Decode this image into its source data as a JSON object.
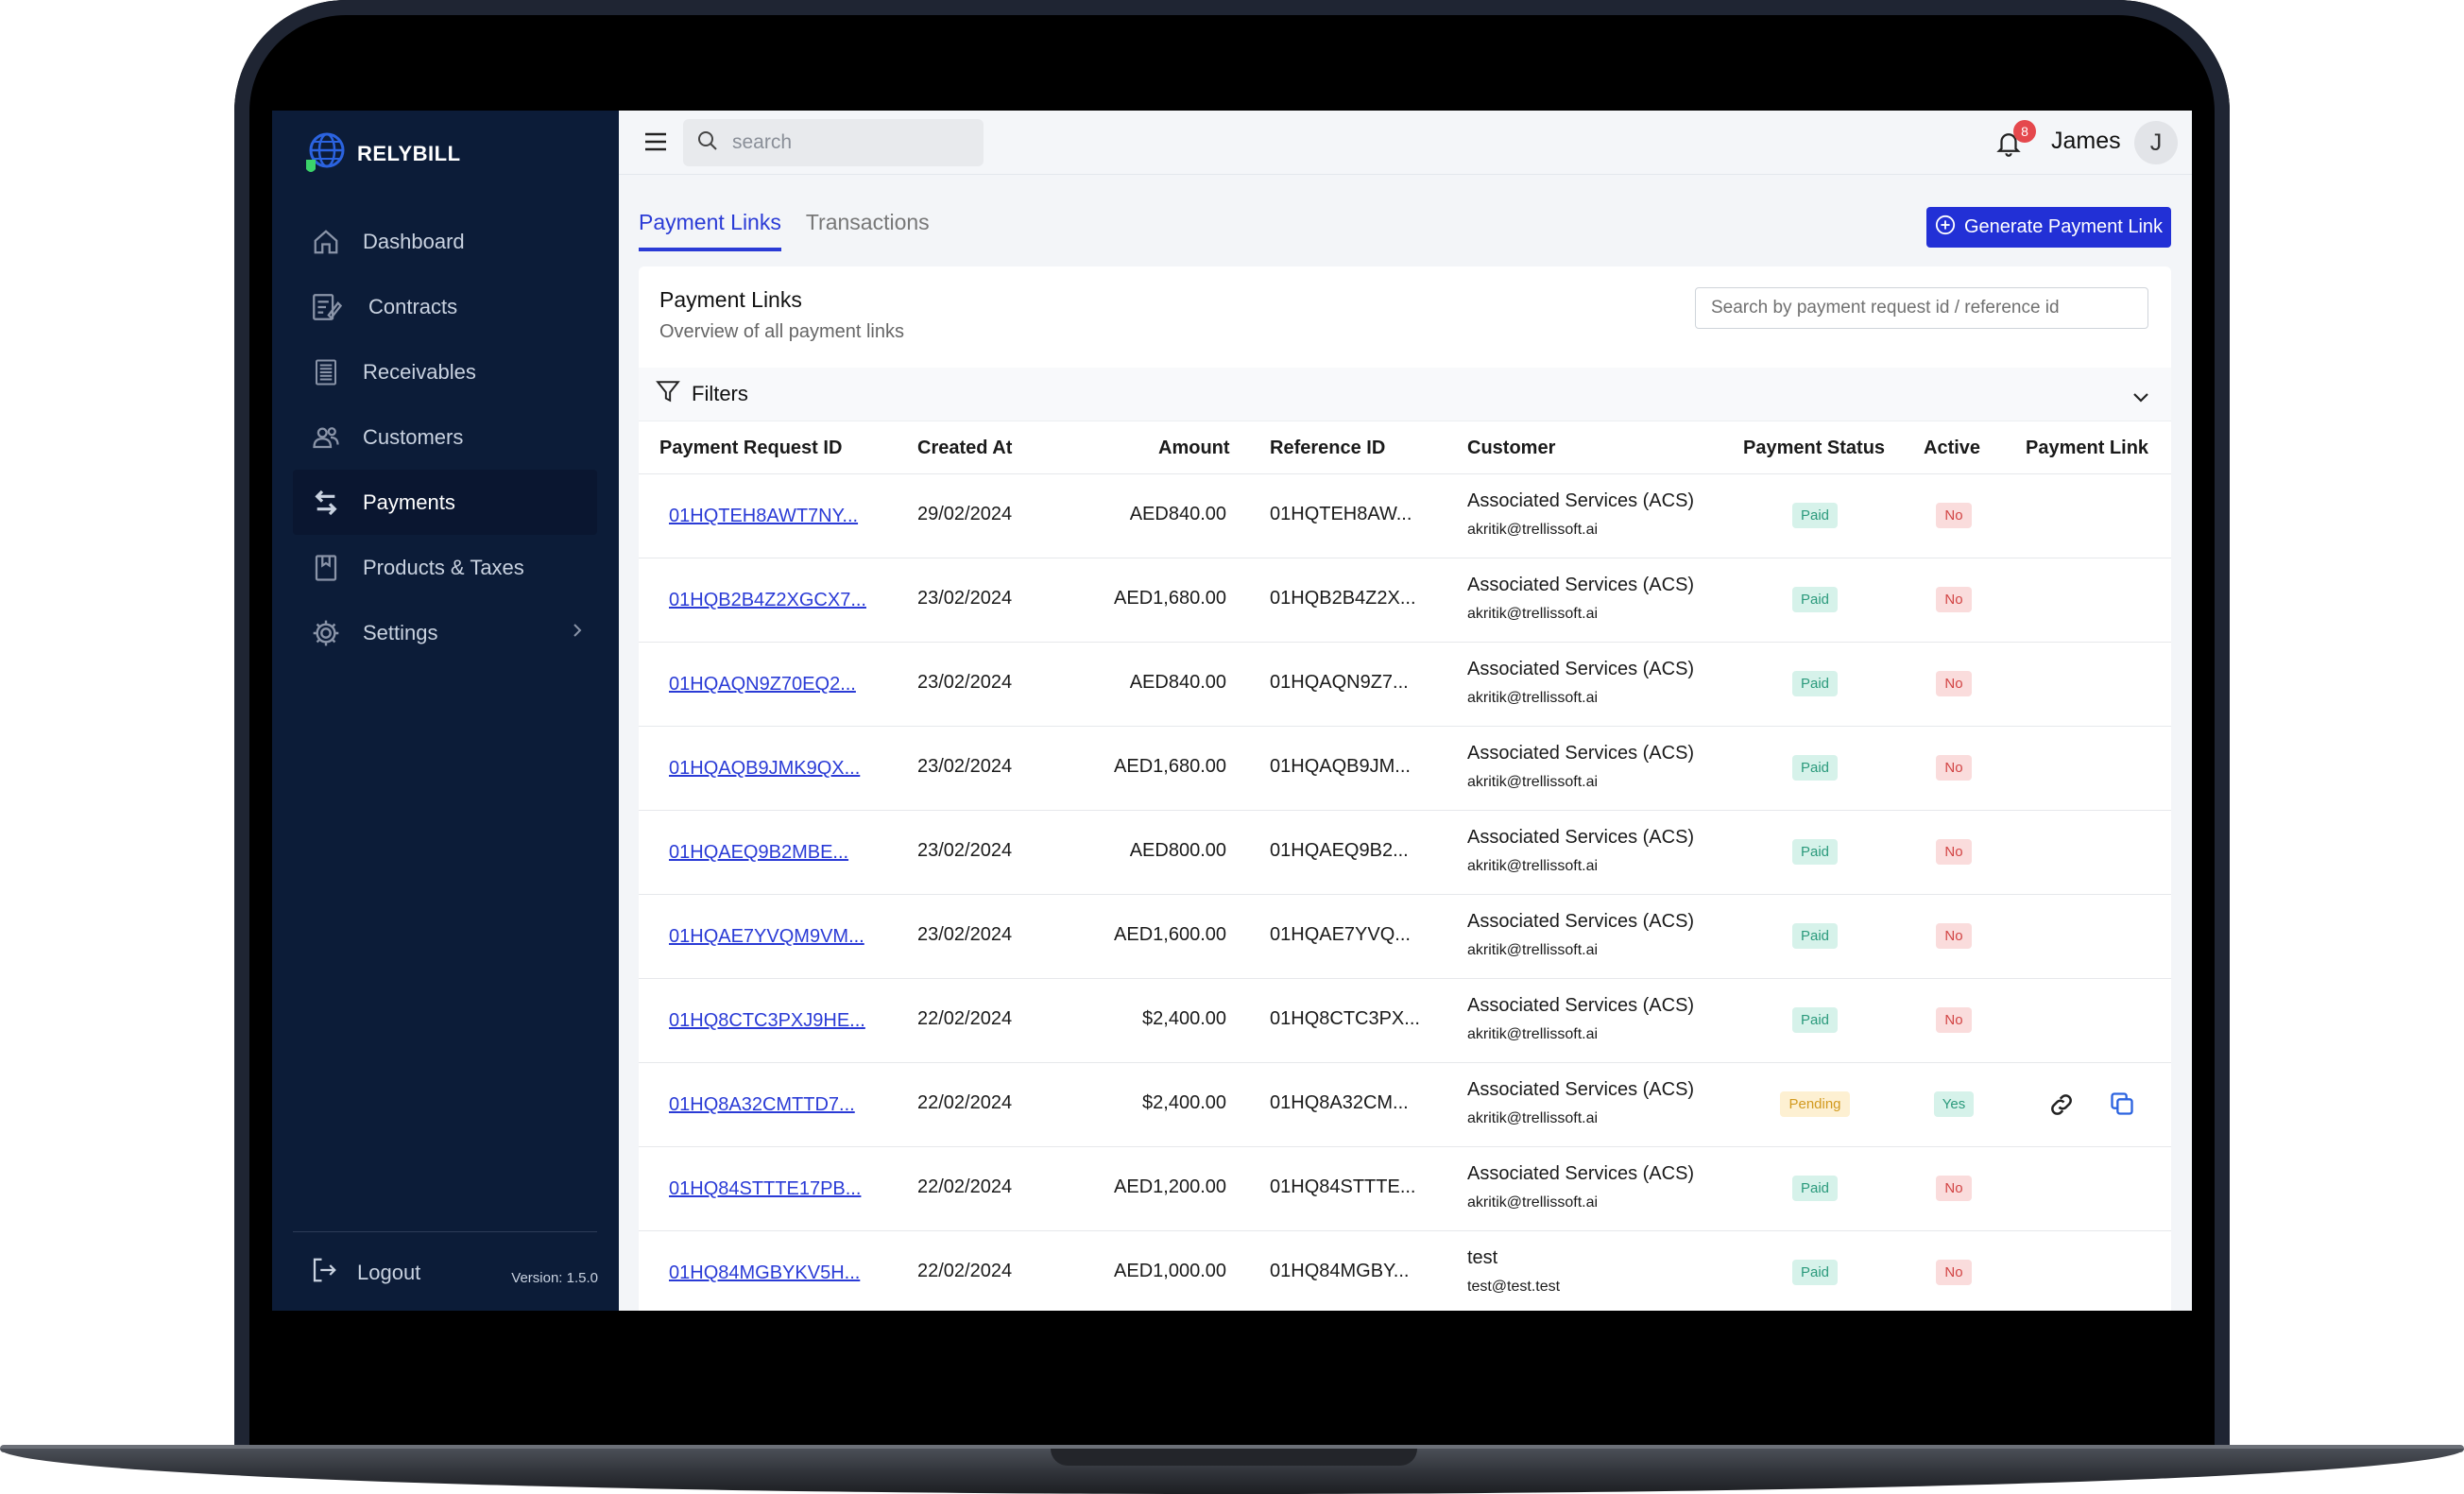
{
  "sidebar": {
    "brand": "RELYBILL",
    "items": [
      {
        "label": "Dashboard",
        "icon": "home-icon",
        "active": false
      },
      {
        "label": "Contracts",
        "icon": "contract-icon",
        "active": false
      },
      {
        "label": "Receivables",
        "icon": "receivables-icon",
        "active": false
      },
      {
        "label": "Customers",
        "icon": "users-icon",
        "active": false
      },
      {
        "label": "Payments",
        "icon": "exchange-icon",
        "active": true
      },
      {
        "label": "Products & Taxes",
        "icon": "bookmark-icon",
        "active": false
      },
      {
        "label": "Settings",
        "icon": "gear-icon",
        "active": false
      }
    ],
    "logout": "Logout",
    "version": "Version: 1.5.0"
  },
  "topbar": {
    "search_placeholder": "search",
    "notification_count": "8",
    "username": "James",
    "avatar_initial": "J"
  },
  "tabs": [
    "Payment Links",
    "Transactions"
  ],
  "generate_button": "Generate Payment Link",
  "card": {
    "title": "Payment Links",
    "subtitle": "Overview of all payment links",
    "search_placeholder": "Search by payment request id / reference id",
    "filters_label": "Filters"
  },
  "table": {
    "headers": [
      "Payment Request ID",
      "Created At",
      "Amount",
      "Reference ID",
      "Customer",
      "Payment Status",
      "Active",
      "Payment Link"
    ],
    "rows": [
      {
        "id": "01HQTEH8AWT7NY...",
        "created": "29/02/2024",
        "amount": "AED840.00",
        "ref": "01HQTEH8AW...",
        "customer": "Associated Services (ACS)",
        "email": "akritik@trellissoft.ai",
        "status": "Paid",
        "active": "No"
      },
      {
        "id": "01HQB2B4Z2XGCX7...",
        "created": "23/02/2024",
        "amount": "AED1,680.00",
        "ref": "01HQB2B4Z2X...",
        "customer": "Associated Services (ACS)",
        "email": "akritik@trellissoft.ai",
        "status": "Paid",
        "active": "No"
      },
      {
        "id": "01HQAQN9Z70EQ2...",
        "created": "23/02/2024",
        "amount": "AED840.00",
        "ref": "01HQAQN9Z7...",
        "customer": "Associated Services (ACS)",
        "email": "akritik@trellissoft.ai",
        "status": "Paid",
        "active": "No"
      },
      {
        "id": "01HQAQB9JMK9QX...",
        "created": "23/02/2024",
        "amount": "AED1,680.00",
        "ref": "01HQAQB9JM...",
        "customer": "Associated Services (ACS)",
        "email": "akritik@trellissoft.ai",
        "status": "Paid",
        "active": "No"
      },
      {
        "id": "01HQAEQ9B2MBE...",
        "created": "23/02/2024",
        "amount": "AED800.00",
        "ref": "01HQAEQ9B2...",
        "customer": "Associated Services (ACS)",
        "email": "akritik@trellissoft.ai",
        "status": "Paid",
        "active": "No"
      },
      {
        "id": "01HQAE7YVQM9VM...",
        "created": "23/02/2024",
        "amount": "AED1,600.00",
        "ref": "01HQAE7YVQ...",
        "customer": "Associated Services (ACS)",
        "email": "akritik@trellissoft.ai",
        "status": "Paid",
        "active": "No"
      },
      {
        "id": "01HQ8CTC3PXJ9HE...",
        "created": "22/02/2024",
        "amount": "$2,400.00",
        "ref": "01HQ8CTC3PX...",
        "customer": "Associated Services (ACS)",
        "email": "akritik@trellissoft.ai",
        "status": "Paid",
        "active": "No"
      },
      {
        "id": "01HQ8A32CMTTD7...",
        "created": "22/02/2024",
        "amount": "$2,400.00",
        "ref": "01HQ8A32CM...",
        "customer": "Associated Services (ACS)",
        "email": "akritik@trellissoft.ai",
        "status": "Pending",
        "active": "Yes"
      },
      {
        "id": "01HQ84STTTE17PB...",
        "created": "22/02/2024",
        "amount": "AED1,200.00",
        "ref": "01HQ84STTTE...",
        "customer": "Associated Services (ACS)",
        "email": "akritik@trellissoft.ai",
        "status": "Paid",
        "active": "No"
      },
      {
        "id": "01HQ84MGBYKV5H...",
        "created": "22/02/2024",
        "amount": "AED1,000.00",
        "ref": "01HQ84MGBY...",
        "customer": "test",
        "email": "test@test.test",
        "status": "Paid",
        "active": "No"
      }
    ]
  },
  "colors": {
    "sidebar": "#0c1c38",
    "accent": "#2230d6",
    "paid": "#2b9a7c",
    "pending": "#d29a1f",
    "inactive": "#d24444"
  }
}
